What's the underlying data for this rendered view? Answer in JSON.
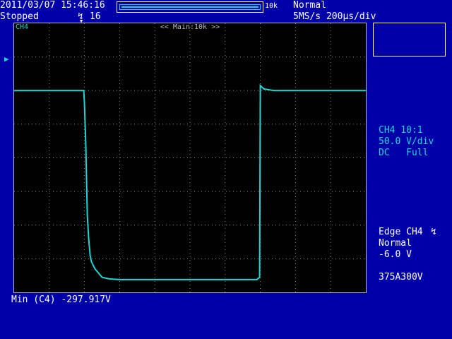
{
  "status": {
    "datetime": "2011/03/07 15:46:16",
    "state": "Stopped",
    "trigger_count": "16",
    "record_length": "10k",
    "trigger_mode": "Normal",
    "sample_rate_timebase": "5MS/s 200µs/div"
  },
  "screen": {
    "channel_tag": "CH4",
    "zoom_label": "<< Main:10k >>"
  },
  "channel": {
    "name_probe": "CH4 10:1",
    "scale": "50.0 V/div",
    "coupling_bw": "DC   Full"
  },
  "trigger": {
    "type_source": "Edge CH4",
    "mode": "Normal",
    "level": "-6.0 V"
  },
  "info_code": "375A300V",
  "measurement": "Min (C4) -297.917V",
  "colors": {
    "background": "#0000a8",
    "screen": "#000000",
    "trace": "#22d4d4",
    "text": "#ffffff"
  },
  "chart_data": {
    "type": "line",
    "series": [
      {
        "x": [
          0,
          1.98,
          2.0,
          2.04,
          2.08,
          2.12,
          2.16,
          2.2,
          2.3,
          2.5,
          2.7,
          3.0,
          4.0,
          5.0,
          6.9,
          6.98,
          7.0,
          7.1,
          7.4,
          10.0
        ],
        "y": [
          0.0,
          0.0,
          -0.4,
          -1.7,
          -3.7,
          -4.4,
          -4.9,
          -5.1,
          -5.3,
          -5.55,
          -5.6,
          -5.62,
          -5.62,
          -5.62,
          -5.62,
          -5.55,
          0.15,
          0.05,
          0.0,
          0.0
        ]
      }
    ],
    "xlim": [
      0,
      10
    ],
    "ylim": [
      -6,
      2
    ],
    "grid": true
  }
}
